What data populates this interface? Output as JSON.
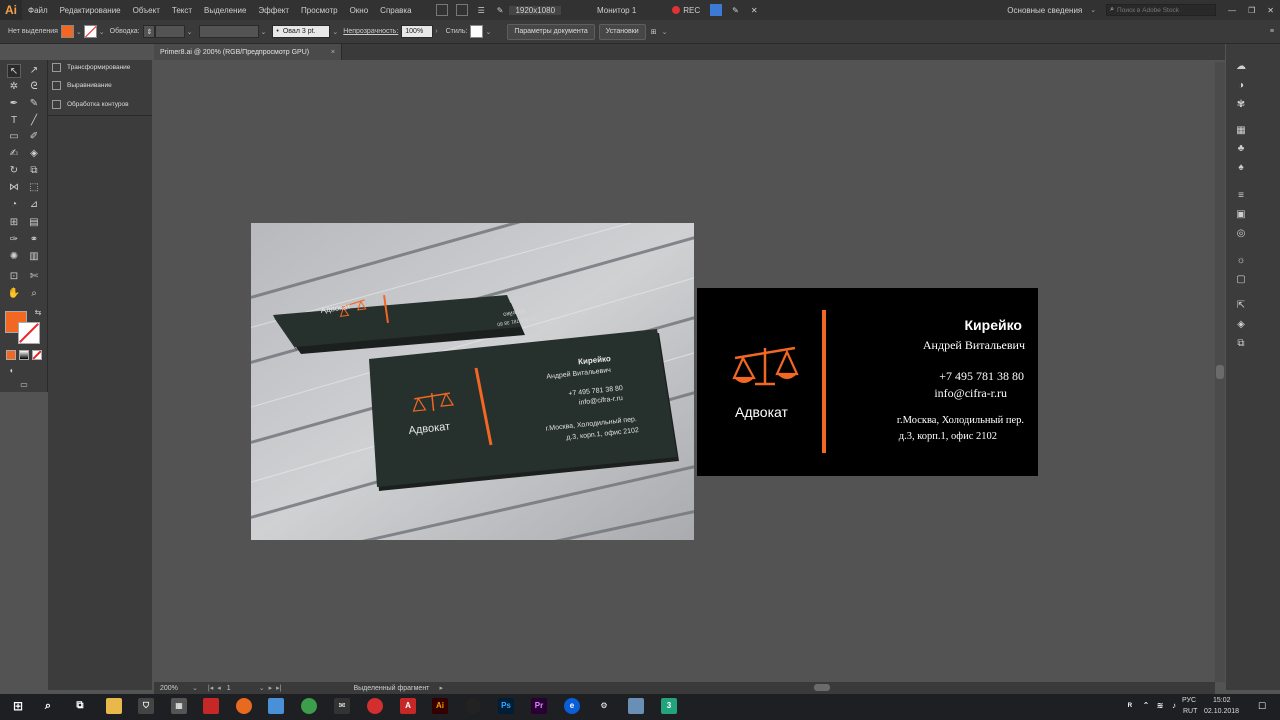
{
  "app": {
    "logo": "Ai",
    "title": "Adobe Illustrator"
  },
  "menu": [
    "Файл",
    "Редактирование",
    "Объект",
    "Текст",
    "Выделение",
    "Эффект",
    "Просмотр",
    "Окно",
    "Справка"
  ],
  "menubar": {
    "resolution": "1920x1080",
    "monitor": "Монитор 1",
    "rec_label": "REC",
    "workspace": "Основные сведения",
    "search_placeholder": "Поиск в Adobe Stock"
  },
  "controlbar": {
    "no_selection": "Нет выделения",
    "stroke_label": "Обводка:",
    "brush_value": "Овал 3 pt.",
    "opacity_label": "Непрозрачность:",
    "opacity_value": "100%",
    "style_label": "Стиль:",
    "doc_params_button": "Параметры документа",
    "prefs_button": "Установки"
  },
  "doc_tab": {
    "title": "Primer8.ai @ 200% (RGB/Предпросмотр GPU)",
    "close": "×"
  },
  "panels": [
    {
      "label": "Трансформирование"
    },
    {
      "label": "Выравнивание"
    },
    {
      "label": "Обработка контуров"
    }
  ],
  "card": {
    "surname": "Кирейко",
    "name": "Андрей Витальевич",
    "phone": "+7 495 781 38 80",
    "email": "info@cifra-r.ru",
    "address1": "г.Москва, Холодильный пер.",
    "address2": "д.3, корп.1, офис 2102",
    "profession": "Адвокат"
  },
  "mockup": {
    "surname": "Кирейко",
    "name": "Андрей Витальевич",
    "phone": "+7 495 781 38 80",
    "email": "info@cifra-r.ru",
    "address1": "г.Москва, Холодильный пер.",
    "address2": "д.3, корп.1, офис 2102",
    "profession": "Адвокат"
  },
  "statusbar": {
    "zoom": "200%",
    "artboard": "1",
    "status": "Выделенный фрагмент"
  },
  "taskbar": {
    "lang": "РУС",
    "layout": "RUT",
    "time": "15:02",
    "date": "02.10.2018"
  },
  "colors": {
    "accent": "#f26722",
    "card_bg": "#000000",
    "mockup_card": "#26302c",
    "canvas": "#535353"
  }
}
